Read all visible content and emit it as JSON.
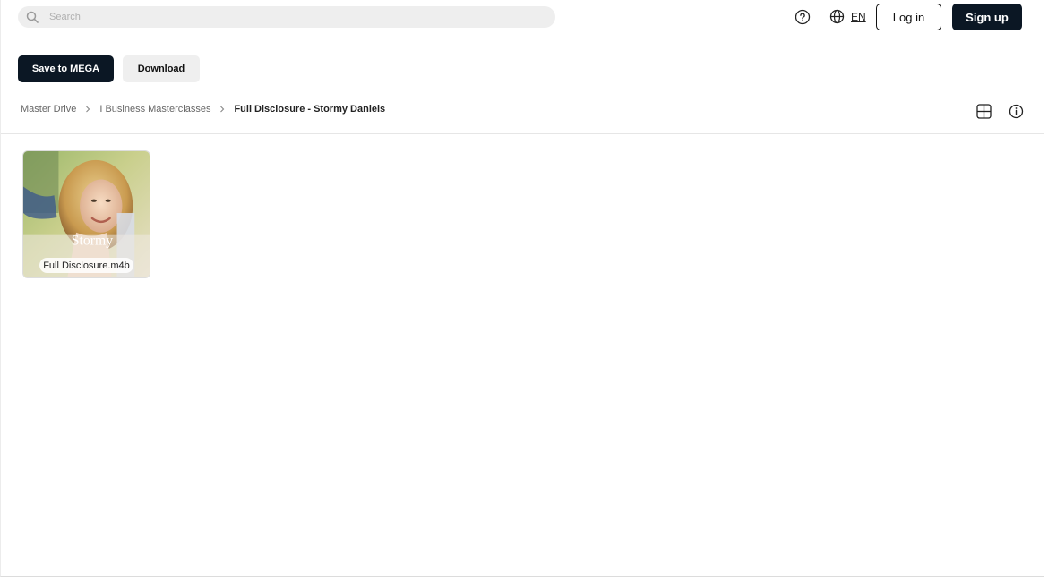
{
  "search": {
    "placeholder": "Search",
    "value": ""
  },
  "header": {
    "language": "EN",
    "login_label": "Log in",
    "signup_label": "Sign up"
  },
  "actions": {
    "save_label": "Save to MEGA",
    "download_label": "Download"
  },
  "breadcrumb": {
    "items": [
      "Master Drive",
      "I Business Masterclasses"
    ],
    "current": "Full Disclosure - Stormy Daniels"
  },
  "files": [
    {
      "name": "Full Disclosure.m4b",
      "thumbnail": "cover-art",
      "thumbnail_text": "Stormy"
    }
  ],
  "colors": {
    "primary_button": "#0b1724",
    "secondary_button": "#efefef",
    "search_background": "#eeeeee"
  },
  "icons": {
    "search": "search-icon",
    "help": "help-icon",
    "globe": "globe-icon",
    "grid": "grid-view-icon",
    "info": "info-icon",
    "chevron": "chevron-right-icon"
  }
}
